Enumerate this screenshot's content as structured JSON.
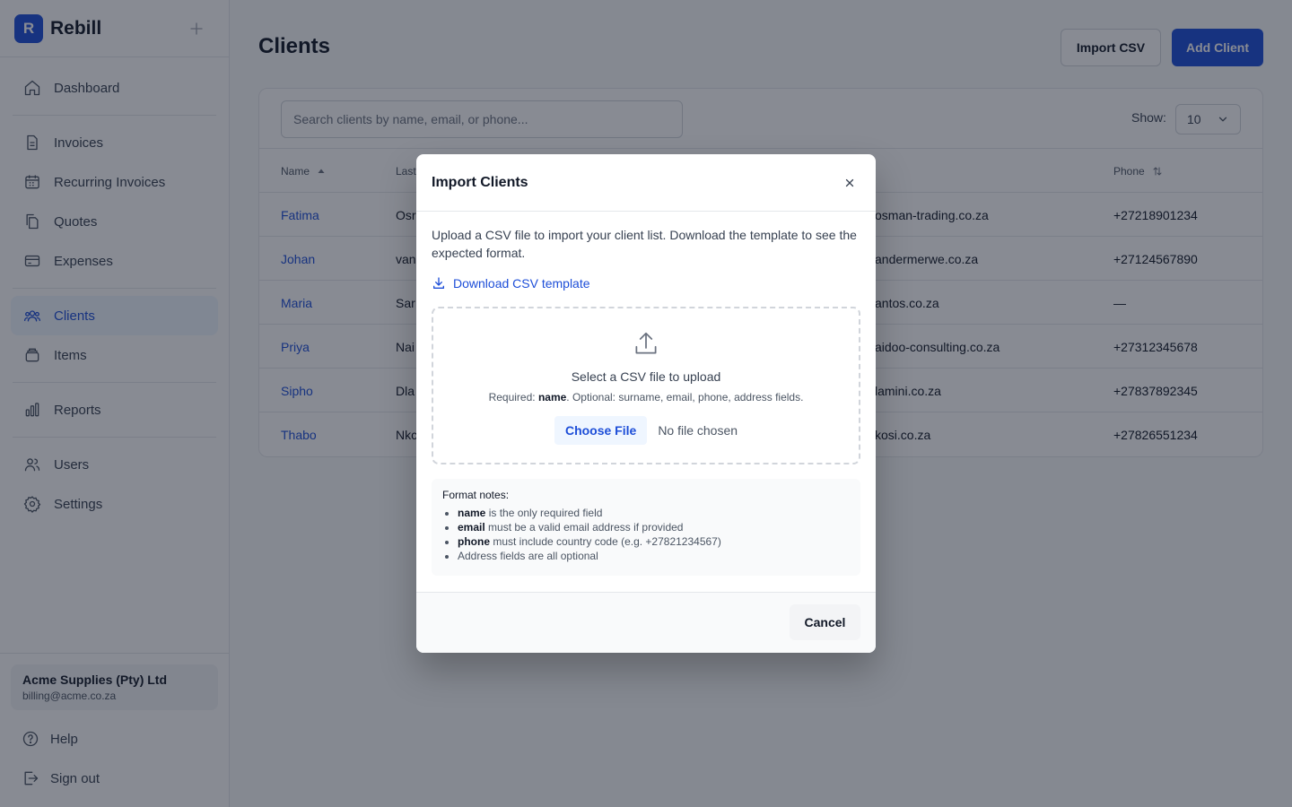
{
  "brand": {
    "logo_letter": "R",
    "name": "Rebill"
  },
  "nav": {
    "dashboard": "Dashboard",
    "invoices": "Invoices",
    "recurring": "Recurring Invoices",
    "quotes": "Quotes",
    "expenses": "Expenses",
    "clients": "Clients",
    "items": "Items",
    "reports": "Reports",
    "users": "Users",
    "settings": "Settings"
  },
  "account": {
    "company": "Acme Supplies (Pty) Ltd",
    "email": "billing@acme.co.za"
  },
  "footer_nav": {
    "help": "Help",
    "signout": "Sign out"
  },
  "page": {
    "title": "Clients",
    "import_button": "Import CSV",
    "add_button": "Add Client"
  },
  "search": {
    "placeholder": "Search clients by name, email, or phone..."
  },
  "pagination": {
    "show_label": "Show:",
    "page_size": "10"
  },
  "table": {
    "columns": {
      "name": "Name",
      "last": "Last",
      "phone": "Phone"
    },
    "rows": [
      {
        "name": "Fatima",
        "last": "Osr",
        "email": "osman-trading.co.za",
        "phone": "+27218901234"
      },
      {
        "name": "Johan",
        "last": "van",
        "email": "andermerwe.co.za",
        "phone": "+27124567890"
      },
      {
        "name": "Maria",
        "last": "Sar",
        "email": "antos.co.za",
        "phone": "—"
      },
      {
        "name": "Priya",
        "last": "Nai",
        "email": "aidoo-consulting.co.za",
        "phone": "+27312345678"
      },
      {
        "name": "Sipho",
        "last": "Dla",
        "email": "lamini.co.za",
        "phone": "+27837892345"
      },
      {
        "name": "Thabo",
        "last": "Nkc",
        "email": "kosi.co.za",
        "phone": "+27826551234"
      }
    ]
  },
  "modal": {
    "title": "Import Clients",
    "description": "Upload a CSV file to import your client list. Download the template to see the expected format.",
    "download_link": "Download CSV template",
    "dropzone_title": "Select a CSV file to upload",
    "required_prefix": "Required: ",
    "required_field": "name",
    "required_suffix": ". Optional: surname, email, phone, address fields.",
    "choose_file": "Choose File",
    "no_file": "No file chosen",
    "notes_title": "Format notes:",
    "notes": [
      {
        "bold": "name",
        "text": " is the only required field"
      },
      {
        "bold": "email",
        "text": " must be a valid email address if provided"
      },
      {
        "bold": "phone",
        "text": " must include country code (e.g. +27821234567)"
      },
      {
        "bold": "",
        "text": "Address fields are all optional"
      }
    ],
    "cancel": "Cancel"
  },
  "colors": {
    "primary": "#1d4ed8",
    "overlay": "rgba(17,24,39,0.5)"
  }
}
